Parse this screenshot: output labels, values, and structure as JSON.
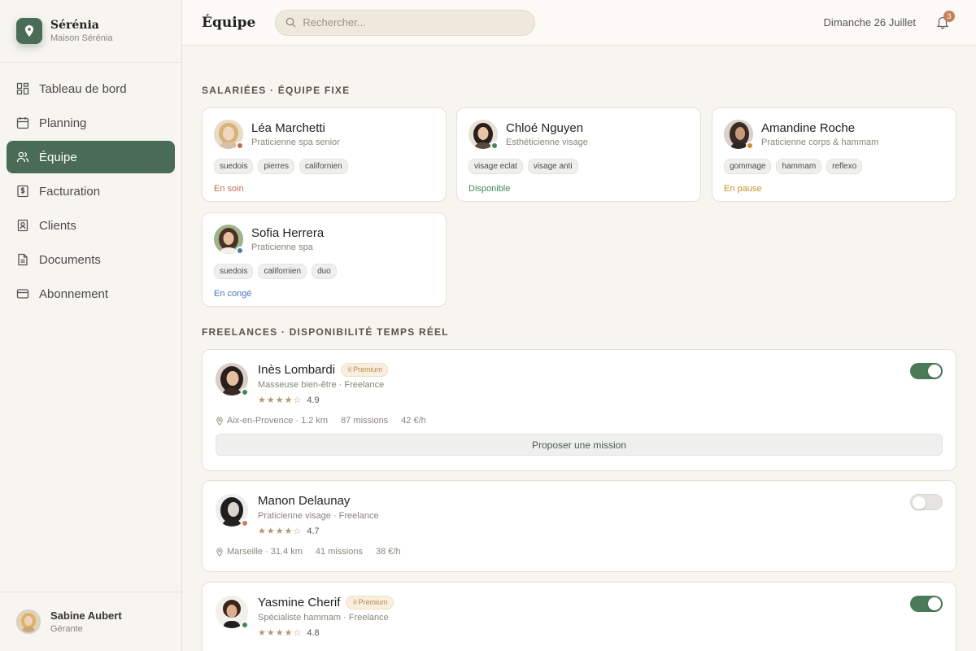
{
  "brand": {
    "name": "Sérénia",
    "subtitle": "Maison Sérénia",
    "logo_icon": "pin-icon",
    "color": "#4a6b55"
  },
  "nav": [
    {
      "label": "Tableau de bord",
      "icon": "dashboard-icon",
      "active": false
    },
    {
      "label": "Planning",
      "icon": "calendar-icon",
      "active": false
    },
    {
      "label": "Équipe",
      "icon": "users-icon",
      "active": true
    },
    {
      "label": "Facturation",
      "icon": "invoice-icon",
      "active": false
    },
    {
      "label": "Clients",
      "icon": "contact-icon",
      "active": false
    },
    {
      "label": "Documents",
      "icon": "document-icon",
      "active": false
    },
    {
      "label": "Abonnement",
      "icon": "card-icon",
      "active": false
    }
  ],
  "user": {
    "name": "Sabine Aubert",
    "role": "Gérante"
  },
  "header": {
    "title": "Équipe",
    "search_placeholder": "Rechercher...",
    "date": "Dimanche 26 Juillet",
    "notification_count": "3"
  },
  "salaried": {
    "title": "Salariées · Équipe fixe",
    "employees": [
      {
        "name": "Léa Marchetti",
        "role": "Praticienne spa senior",
        "tags": [
          "suedois",
          "pierres",
          "californien"
        ],
        "status": "En soin",
        "status_color": "#c07050"
      },
      {
        "name": "Chloé Nguyen",
        "role": "Esthéticienne visage",
        "tags": [
          "visage eclat",
          "visage anti"
        ],
        "status": "Disponible",
        "status_color": "#3e8a55"
      },
      {
        "name": "Amandine Roche",
        "role": "Praticienne corps & hammam",
        "tags": [
          "gommage",
          "hammam",
          "reflexo"
        ],
        "status": "En pause",
        "status_color": "#c8922a"
      },
      {
        "name": "Sofia Herrera",
        "role": "Praticienne spa",
        "tags": [
          "suedois",
          "californien",
          "duo"
        ],
        "status": "En congé",
        "status_color": "#4a7ab0"
      }
    ]
  },
  "freelance": {
    "title": "Freelances · Disponibilité temps réel",
    "mission_label": "Proposer une mission",
    "items": [
      {
        "name": "Inès Lombardi",
        "premium": "Premium",
        "role": "Masseuse bien-être · Freelance",
        "rating": "4.9",
        "location": "Aix-en-Provence · 1.2 km",
        "missions": "87 missions",
        "rate": "42 €/h",
        "available": true,
        "status_color": "#3e8a55"
      },
      {
        "name": "Manon Delaunay",
        "premium": "",
        "role": "Praticienne visage · Freelance",
        "rating": "4.7",
        "location": "Marseille · 31.4 km",
        "missions": "41 missions",
        "rate": "38 €/h",
        "available": false,
        "status_color": "#c8805a"
      },
      {
        "name": "Yasmine Cherif",
        "premium": "Premium",
        "role": "Spécialiste hammam · Freelance",
        "rating": "4.8",
        "location": "",
        "missions": "",
        "rate": "",
        "available": true,
        "status_color": "#3e8a55"
      }
    ]
  }
}
